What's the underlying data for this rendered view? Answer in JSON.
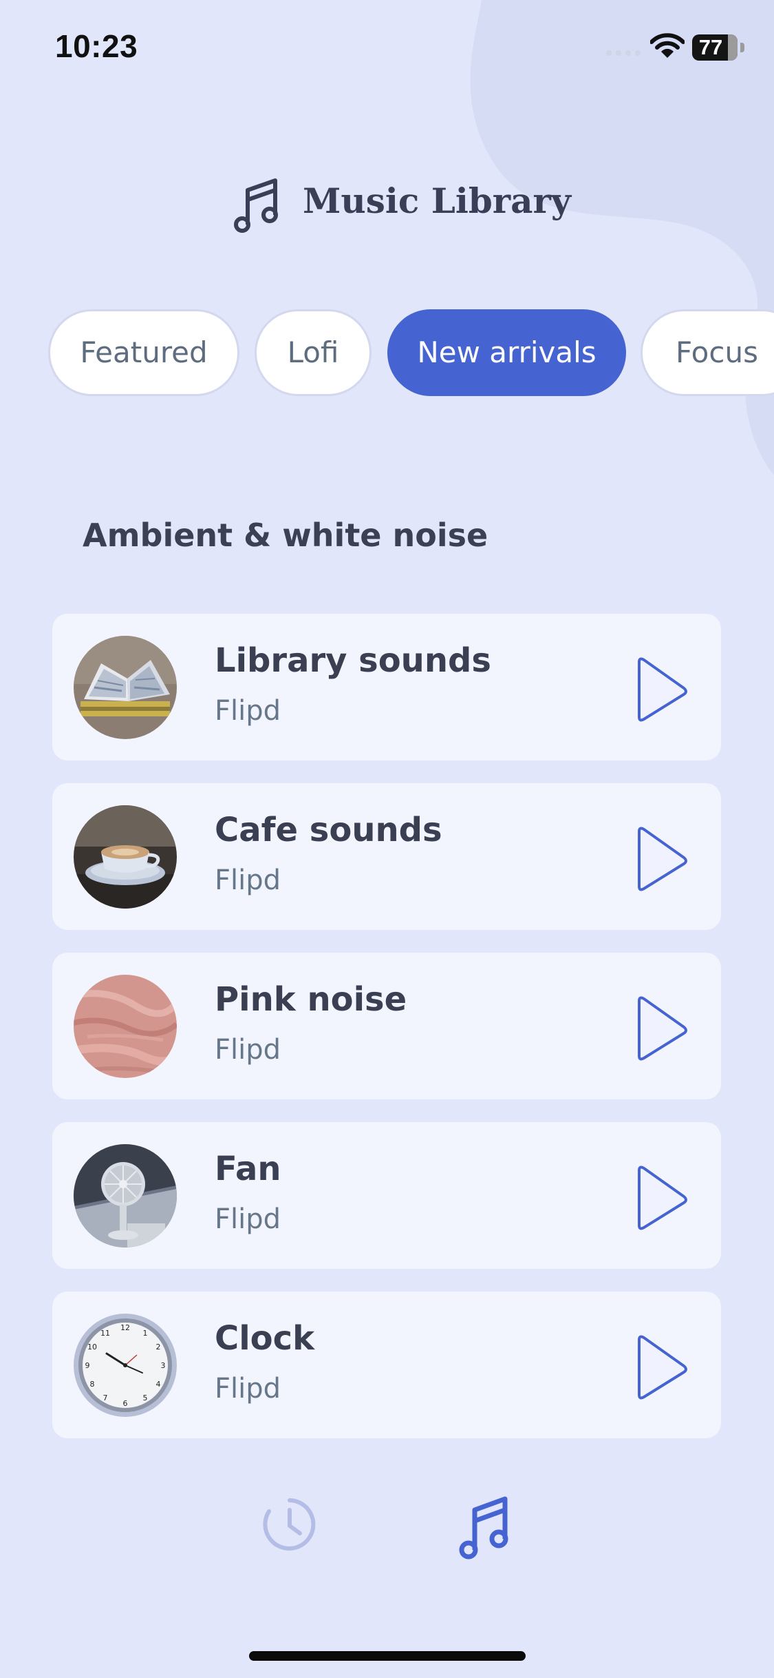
{
  "status_bar": {
    "time": "10:23",
    "battery_level": "77"
  },
  "header": {
    "title": "Music Library",
    "icon": "music-note-icon"
  },
  "tabs": [
    {
      "label": "Featured",
      "active": false
    },
    {
      "label": "Lofi",
      "active": false
    },
    {
      "label": "New arrivals",
      "active": true
    },
    {
      "label": "Focus",
      "active": false
    }
  ],
  "section": {
    "title": "Ambient & white noise"
  },
  "tracks": [
    {
      "title": "Library sounds",
      "artist": "Flipd",
      "thumbnail": "book-photo"
    },
    {
      "title": "Cafe sounds",
      "artist": "Flipd",
      "thumbnail": "coffee-cup-photo"
    },
    {
      "title": "Pink noise",
      "artist": "Flipd",
      "thumbnail": "pink-marble-photo"
    },
    {
      "title": "Fan",
      "artist": "Flipd",
      "thumbnail": "desk-fan-photo"
    },
    {
      "title": "Clock",
      "artist": "Flipd",
      "thumbnail": "wall-clock-photo"
    }
  ],
  "bottom_nav": [
    {
      "name": "timer",
      "icon": "timer-icon",
      "active": false
    },
    {
      "name": "music",
      "icon": "music-note-icon",
      "active": true
    }
  ],
  "colors": {
    "background": "#e1e6fa",
    "accent": "#4664d1",
    "card": "#f2f4fe",
    "title_text": "#3b3f52",
    "subtitle_text": "#67778a"
  }
}
